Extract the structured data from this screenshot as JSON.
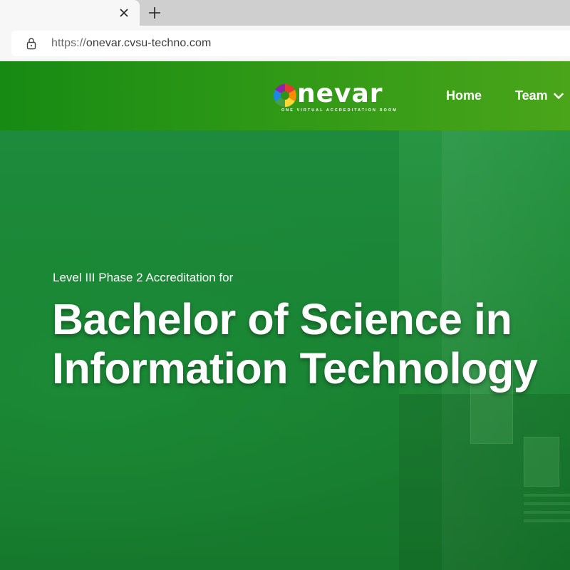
{
  "browser": {
    "tab": {
      "title": "",
      "close_icon": "close-icon"
    },
    "new_tab_icon": "plus-icon",
    "address_bar": {
      "lock_icon": "lock-icon",
      "url_protocol": "https://",
      "url_host": "onevar.cvsu-techno.com"
    }
  },
  "header": {
    "logo": {
      "wordmark": "nevar",
      "tagline": "ONE VIRTUAL ACCREDITATION ROOM",
      "colors": [
        "#e53935",
        "#fb8c00",
        "#fdd835",
        "#43a047",
        "#1e88e5",
        "#8e24aa"
      ]
    },
    "nav": [
      {
        "label": "Home"
      },
      {
        "label": "Team",
        "icon": "chevron-down-icon"
      }
    ],
    "gradient": [
      "#178a14",
      "#4aa51a"
    ]
  },
  "hero": {
    "kicker": "Level III Phase 2 Accreditation for",
    "title_line1": "Bachelor of Science in",
    "title_line2": "Information Technology",
    "background_color": "#1a8434"
  }
}
